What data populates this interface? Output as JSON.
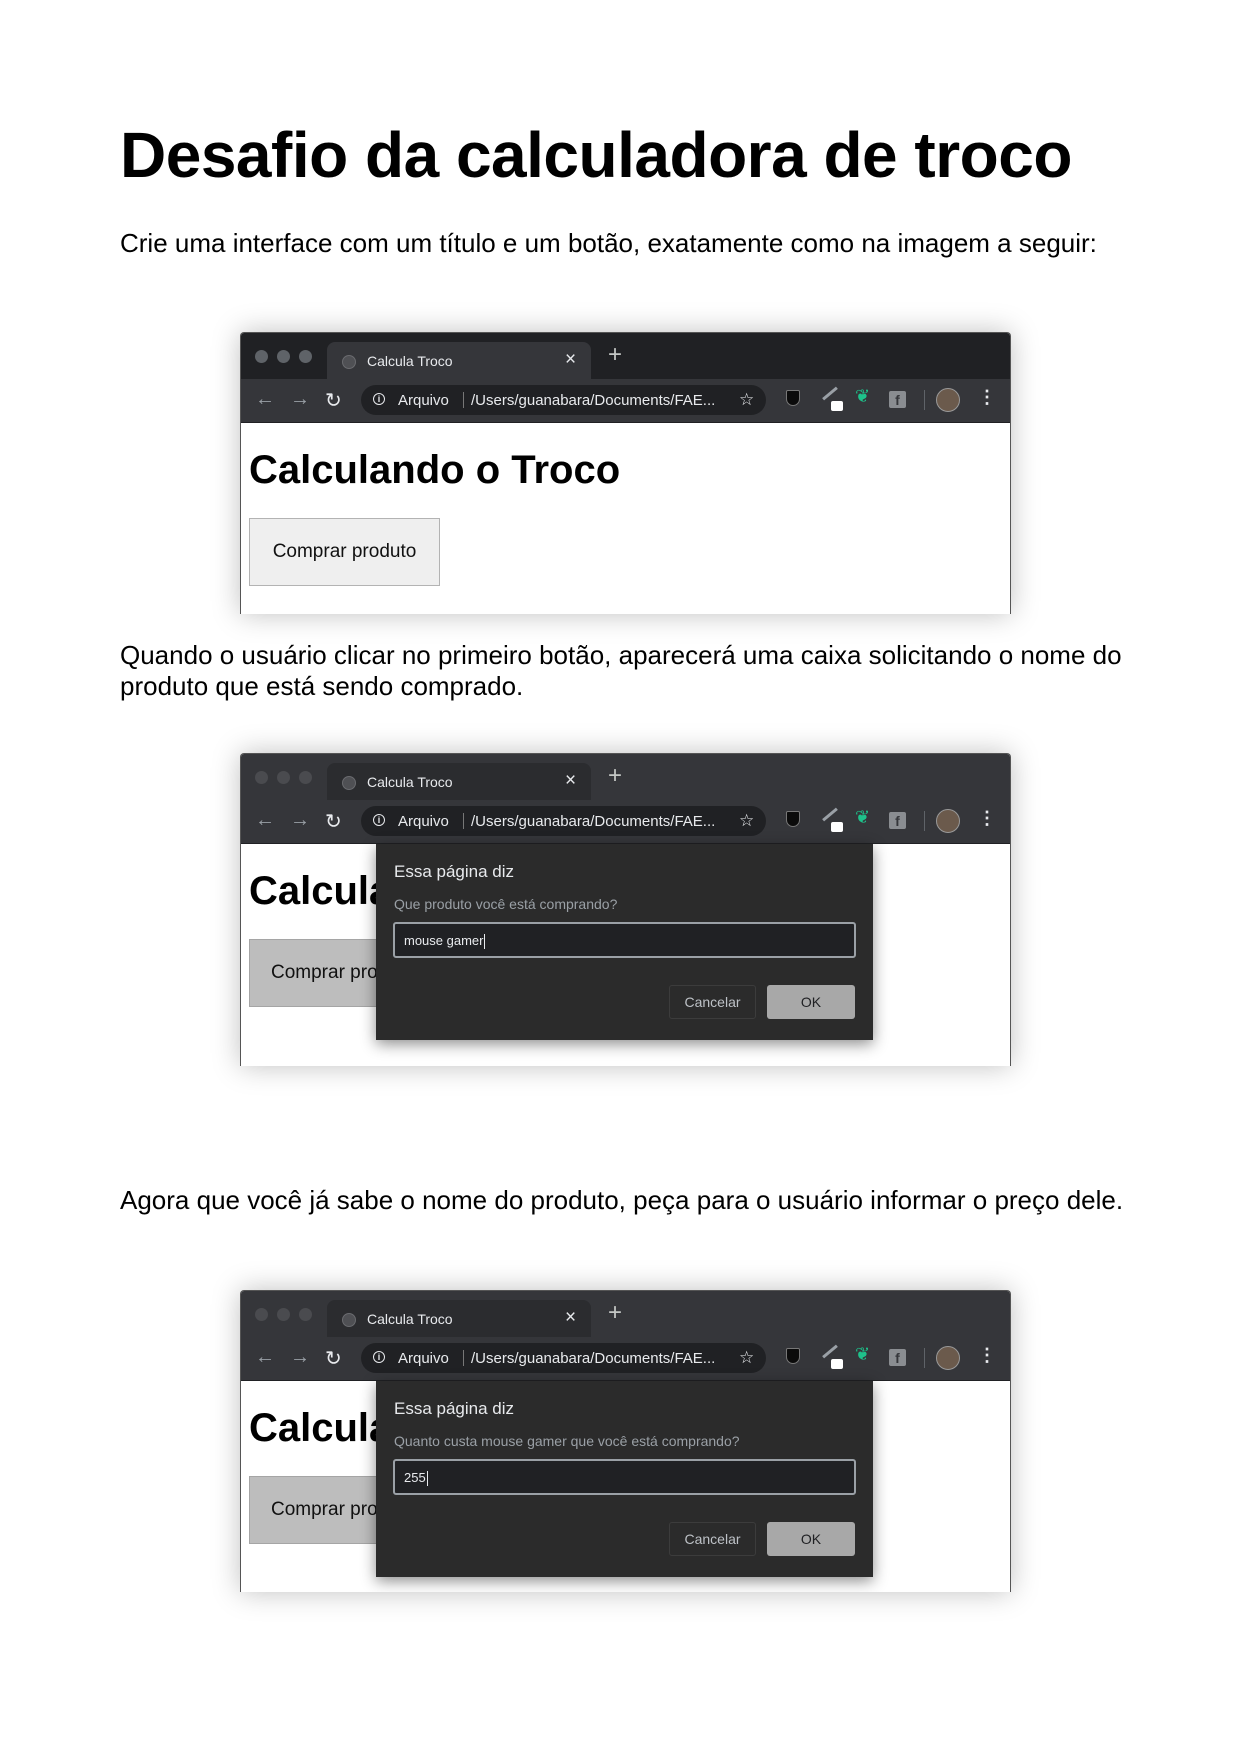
{
  "document": {
    "title": "Desafio da calculadora de troco",
    "paragraphs": [
      "Crie uma interface com um título e um botão, exatamente como na imagem a seguir:",
      "Quando o usuário clicar no primeiro botão, aparecerá uma caixa solicitando o nome do produto que está sendo comprado.",
      "Agora que você já sabe o nome do produto, peça para o usuário informar o preço dele."
    ]
  },
  "browser": {
    "tab_title": "Calcula Troco",
    "close_glyph": "×",
    "new_tab_glyph": "+",
    "back_glyph": "←",
    "forward_glyph": "→",
    "reload_glyph": "↻",
    "info_glyph": "i",
    "scheme_label": "Arquivo",
    "url": "/Users/guanabara/Documents/FAE...",
    "star_glyph": "☆",
    "feather_glyph": "❦",
    "fb_glyph": "f",
    "menu_glyph": "⋮"
  },
  "page": {
    "heading": "Calculando o Troco",
    "heading_clipped": "Calcula",
    "button": "Comprar produto",
    "button_clipped": "Comprar pro"
  },
  "dialogs": [
    {
      "title": "Essa página diz",
      "message": "Que produto você está comprando?",
      "input_value": "mouse gamer",
      "cancel": "Cancelar",
      "ok": "OK"
    },
    {
      "title": "Essa página diz",
      "message": "Quanto custa mouse gamer que você está comprando?",
      "input_value": "255",
      "cancel": "Cancelar",
      "ok": "OK"
    }
  ],
  "colors": {
    "chrome_dark": "#202124",
    "chrome_toolbar": "#35363a",
    "dialog_bg": "#2b2b2b",
    "extension_green": "#1ec28b",
    "ok_button": "#a8a8a8"
  }
}
